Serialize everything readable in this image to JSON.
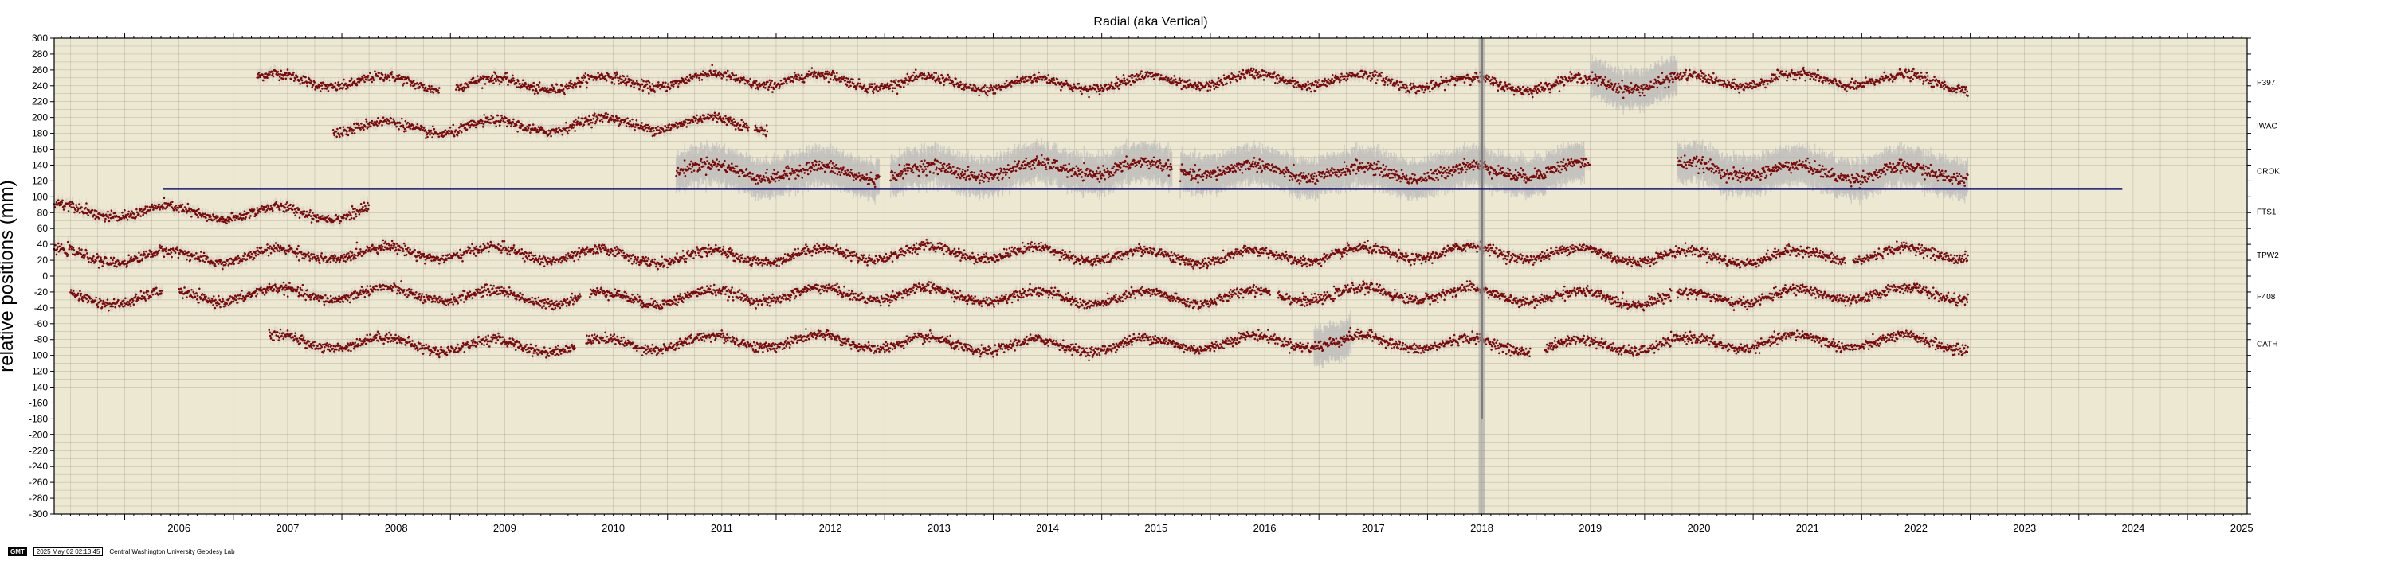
{
  "chart_data": {
    "type": "scatter",
    "title": "Radial (aka Vertical)",
    "ylabel": "relative positions (mm)",
    "xlabel": "",
    "xlim": [
      2005.35,
      2025.55
    ],
    "ylim": [
      -300,
      300
    ],
    "y_tick_step": 20,
    "x_ticks": [
      "2006",
      "2007",
      "2008",
      "2009",
      "2010",
      "2011",
      "2012",
      "2013",
      "2014",
      "2015",
      "2016",
      "2017",
      "2018",
      "2019",
      "2020",
      "2021",
      "2022",
      "2023",
      "2024",
      "2025"
    ],
    "grid": true,
    "colors": {
      "background": "#ede8d2",
      "grid": "#8a8a80",
      "points": "#7a0a0a",
      "error_band": "#b8b8b8",
      "reference_line": "#1a1a7a"
    },
    "reference_line": {
      "y": 110,
      "x_start": 2006.35,
      "x_end": 2024.4
    },
    "series": [
      {
        "name": "P397",
        "offset": 245,
        "start": 2007.22,
        "end": 2022.98,
        "gaps": [
          [
            2008.9,
            2009.05
          ]
        ],
        "noisy": [
          [
            2019.5,
            2020.3
          ]
        ]
      },
      {
        "name": "IWAC",
        "offset": 190,
        "start": 2007.92,
        "end": 2011.92,
        "gaps": [
          [
            2011.75,
            2011.8
          ]
        ],
        "noisy": []
      },
      {
        "name": "CROK",
        "offset": 133,
        "start": 2011.08,
        "end": 2022.98,
        "gaps": [
          [
            2012.95,
            2013.05
          ],
          [
            2015.65,
            2015.72
          ],
          [
            2019.5,
            2020.3
          ]
        ],
        "noisy": [
          [
            2011.08,
            2019.45
          ],
          [
            2020.3,
            2022.98
          ]
        ]
      },
      {
        "name": "FTS1",
        "offset": 82,
        "start": 2005.35,
        "end": 2008.25,
        "gaps": [],
        "noisy": []
      },
      {
        "name": "TPW2",
        "offset": 27,
        "start": 2005.35,
        "end": 2022.98,
        "gaps": [
          [
            2021.85,
            2021.92
          ]
        ],
        "noisy": []
      },
      {
        "name": "P408",
        "offset": -25,
        "start": 2005.5,
        "end": 2022.98,
        "gaps": [
          [
            2006.35,
            2006.5
          ],
          [
            2010.2,
            2010.28
          ],
          [
            2016.55,
            2016.62
          ],
          [
            2020.25,
            2020.3
          ]
        ],
        "noisy": []
      },
      {
        "name": "CATH",
        "offset": -85,
        "start": 2007.33,
        "end": 2022.98,
        "gaps": [
          [
            2010.15,
            2010.25
          ],
          [
            2018.95,
            2019.08
          ]
        ],
        "noisy": [
          [
            2016.95,
            2017.3
          ]
        ]
      }
    ],
    "event": {
      "x": 2018.5,
      "note": "vertical gray spike"
    }
  },
  "footer": {
    "badge": "GMT",
    "timestamp": "2025 May 02 02:13:45",
    "credit": "Central Washington University Geodesy Lab"
  }
}
